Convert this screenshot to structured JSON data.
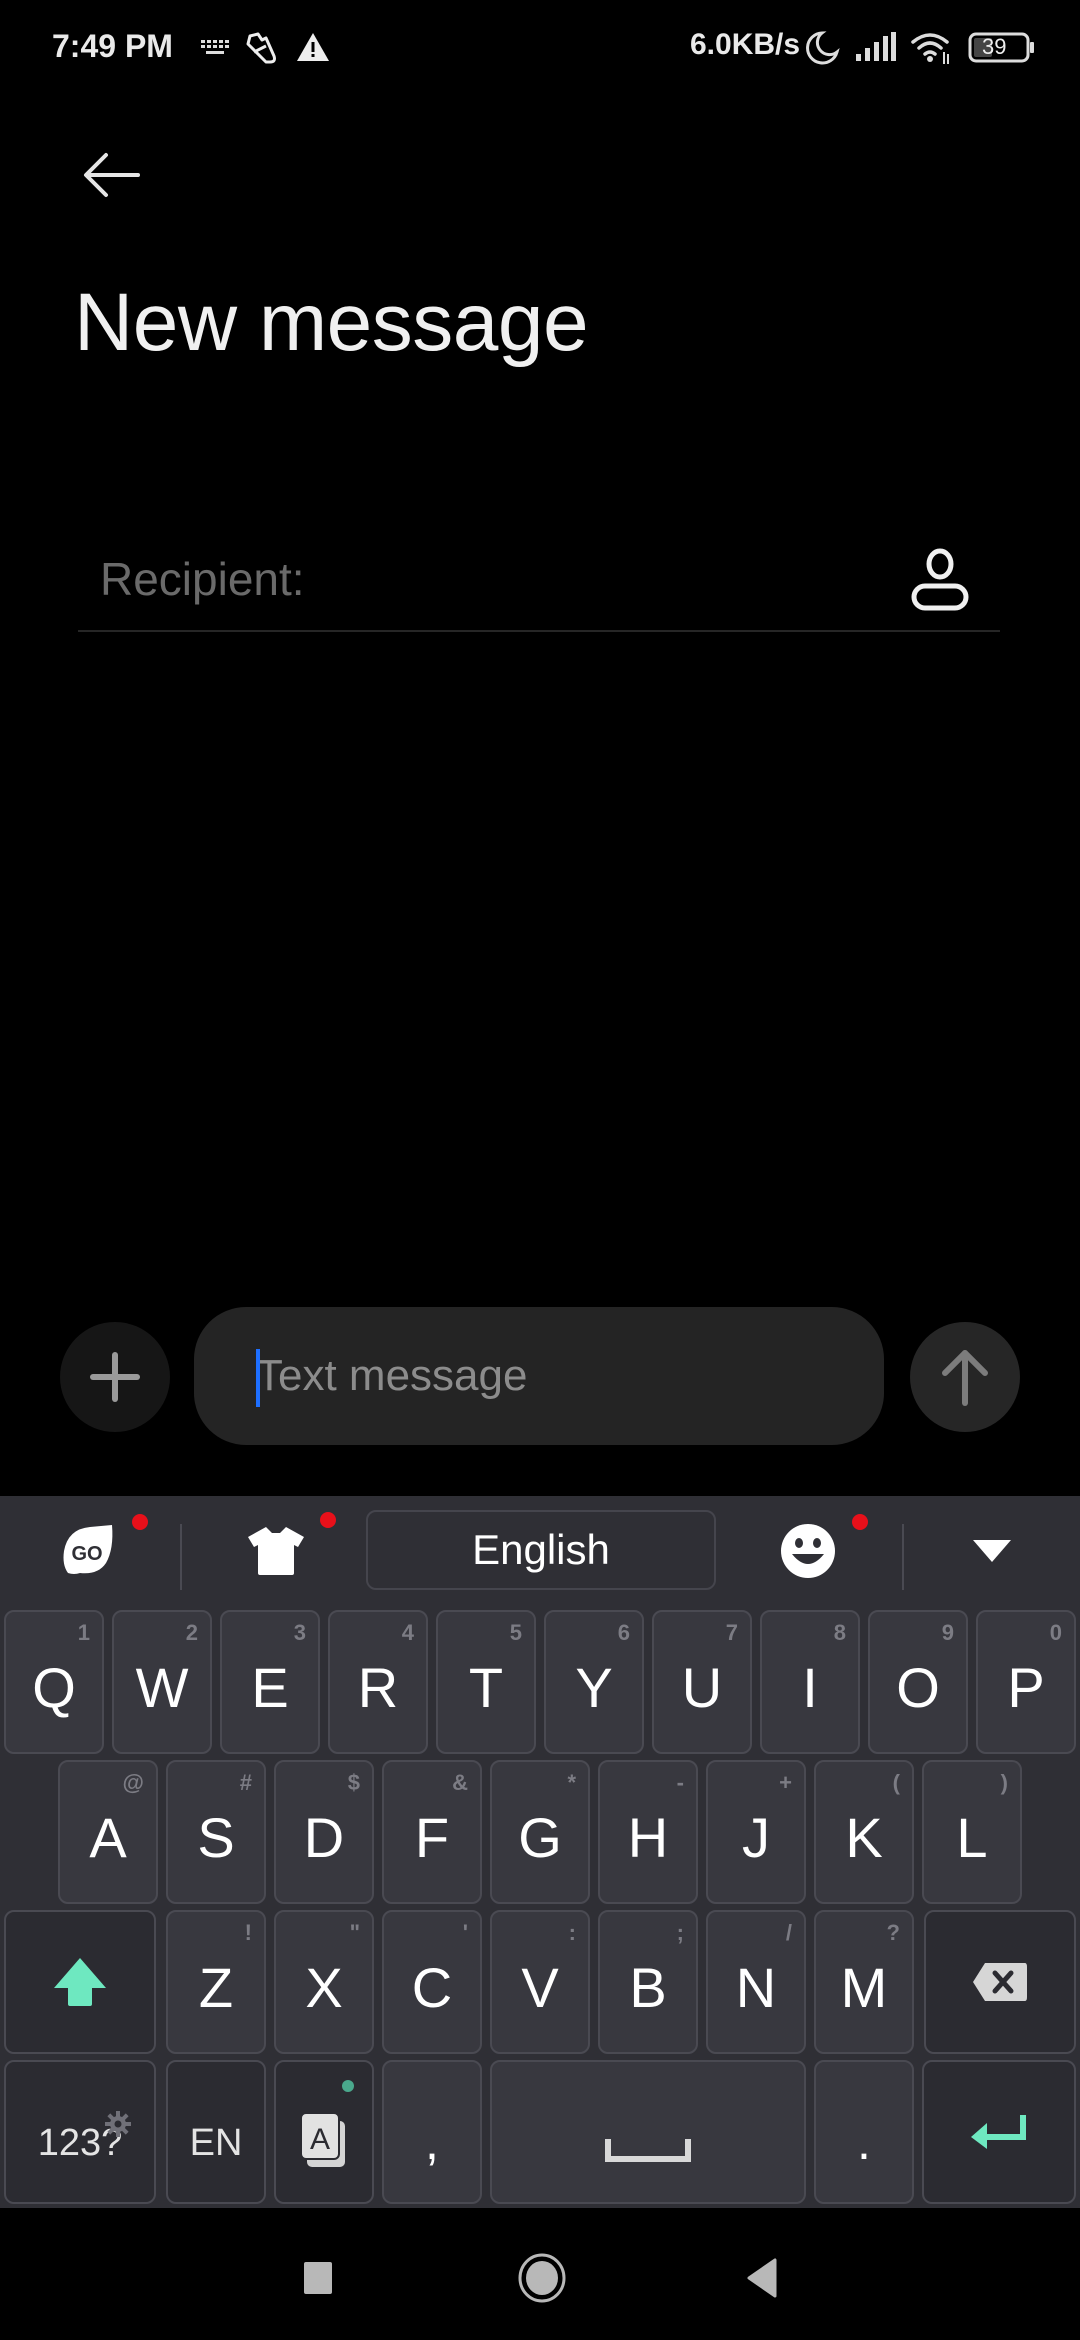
{
  "status_bar": {
    "time": "7:49 PM",
    "left_icons": [
      "keyboard-icon",
      "shoe-icon",
      "warning-icon"
    ],
    "net_speed": "6.0KB/s",
    "right_icons": [
      "do-not-disturb-moon-icon",
      "signal-icon",
      "wifi-icon",
      "battery-icon"
    ],
    "battery_level": "39"
  },
  "header": {
    "back_icon": "arrow-left-icon",
    "title": "New message"
  },
  "recipient": {
    "placeholder": "Recipient:",
    "value": "",
    "contact_icon": "person-icon"
  },
  "compose": {
    "attach_icon": "plus-icon",
    "placeholder": "Text message",
    "value": "",
    "send_icon": "arrow-up-icon"
  },
  "keyboard": {
    "toolbar": {
      "go_icon": "go-keyboard-icon",
      "theme_icon": "tshirt-icon",
      "language": "English",
      "emoji_icon": "smiley-icon",
      "collapse_icon": "triangle-down-icon",
      "notification_color": "#e8101a"
    },
    "rows": [
      [
        {
          "label": "Q",
          "hint": "1"
        },
        {
          "label": "W",
          "hint": "2"
        },
        {
          "label": "E",
          "hint": "3"
        },
        {
          "label": "R",
          "hint": "4"
        },
        {
          "label": "T",
          "hint": "5"
        },
        {
          "label": "Y",
          "hint": "6"
        },
        {
          "label": "U",
          "hint": "7"
        },
        {
          "label": "I",
          "hint": "8"
        },
        {
          "label": "O",
          "hint": "9"
        },
        {
          "label": "P",
          "hint": "0"
        }
      ],
      [
        {
          "label": "A",
          "hint": "@"
        },
        {
          "label": "S",
          "hint": "#"
        },
        {
          "label": "D",
          "hint": "$"
        },
        {
          "label": "F",
          "hint": "&"
        },
        {
          "label": "G",
          "hint": "*"
        },
        {
          "label": "H",
          "hint": "-"
        },
        {
          "label": "J",
          "hint": "+"
        },
        {
          "label": "K",
          "hint": "("
        },
        {
          "label": "L",
          "hint": ")"
        }
      ],
      [
        {
          "label": "Z",
          "hint": "!"
        },
        {
          "label": "X",
          "hint": "\""
        },
        {
          "label": "C",
          "hint": "'"
        },
        {
          "label": "V",
          "hint": ":"
        },
        {
          "label": "B",
          "hint": ";"
        },
        {
          "label": "N",
          "hint": "/"
        },
        {
          "label": "M",
          "hint": "?"
        }
      ]
    ],
    "shift_icon": "shift-arrow-icon",
    "backspace_icon": "backspace-icon",
    "bottom": {
      "symbols": "123?",
      "settings_icon": "gear-icon",
      "language_key": "EN",
      "clipboard_icon": "text-clipboard-icon",
      "comma": ",",
      "space_icon": "space-bar-icon",
      "period": ".",
      "enter_icon": "enter-icon"
    },
    "accent_color": "#6ee8c0"
  },
  "nav_bar": {
    "recents_icon": "square-icon",
    "home_icon": "circle-icon",
    "back_icon": "triangle-back-icon"
  }
}
